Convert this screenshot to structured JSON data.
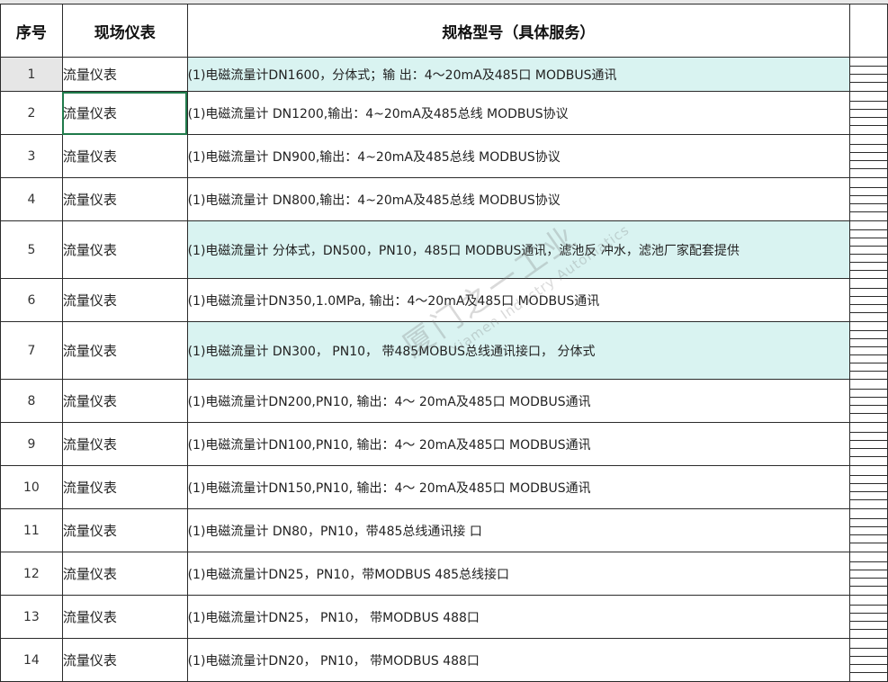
{
  "header": {
    "col_num": "序号",
    "col_type": "现场仪表",
    "col_spec": "规格型号（具体服务）"
  },
  "rows": [
    {
      "num": "1",
      "type": "流量仪表",
      "spec": "(1)电磁流量计DN1600，分体式；输 出：4～20mA及485口 MODBUS通讯"
    },
    {
      "num": "2",
      "type": "流量仪表",
      "spec": "(1)电磁流量计 DN1200,输出：4~20mA及485总线 MODBUS协议"
    },
    {
      "num": "3",
      "type": "流量仪表",
      "spec": "(1)电磁流量计 DN900,输出：4~20mA及485总线 MODBUS协议"
    },
    {
      "num": "4",
      "type": "流量仪表",
      "spec": "(1)电磁流量计 DN800,输出：4~20mA及485总线 MODBUS协议"
    },
    {
      "num": "5",
      "type": "流量仪表",
      "spec": "(1)电磁流量计 分体式，DN500，PN10，485口 MODBUS通讯，滤池反 冲水，滤池厂家配套提供"
    },
    {
      "num": "6",
      "type": "流量仪表",
      "spec": "(1)电磁流量计DN350,1.0MPa, 输出：4～20mA及485口 MODBUS通讯"
    },
    {
      "num": "7",
      "type": "流量仪表",
      "spec": "(1)电磁流量计 DN300，  PN10，  带485MOBUS总线通讯接口，  分体式"
    },
    {
      "num": "8",
      "type": "流量仪表",
      "spec": "(1)电磁流量计DN200,PN10, 输出：4～ 20mA及485口 MODBUS通讯"
    },
    {
      "num": "9",
      "type": "流量仪表",
      "spec": "(1)电磁流量计DN100,PN10, 输出：4～ 20mA及485口 MODBUS通讯"
    },
    {
      "num": "10",
      "type": "流量仪表",
      "spec": "(1)电磁流量计DN150,PN10, 输出：4～ 20mA及485口 MODBUS通讯"
    },
    {
      "num": "11",
      "type": "流量仪表",
      "spec": "(1)电磁流量计 DN80，PN10，带485总线通讯接 口"
    },
    {
      "num": "12",
      "type": "流量仪表",
      "spec": "(1)电磁流量计DN25，PN10，带MODBUS 485总线接口"
    },
    {
      "num": "13",
      "type": "流量仪表",
      "spec": "(1)电磁流量计DN25，  PN10，  带MODBUS 488口"
    },
    {
      "num": "14",
      "type": "流量仪表",
      "spec": "(1)电磁流量计DN20，  PN10，  带MODBUS 488口"
    }
  ],
  "highlight_color": "#d9f3f1",
  "selection_color": "#1f7a4a",
  "watermark": {
    "text": "厦门之一工业",
    "sub": "Xiamen Industry Automatics"
  }
}
